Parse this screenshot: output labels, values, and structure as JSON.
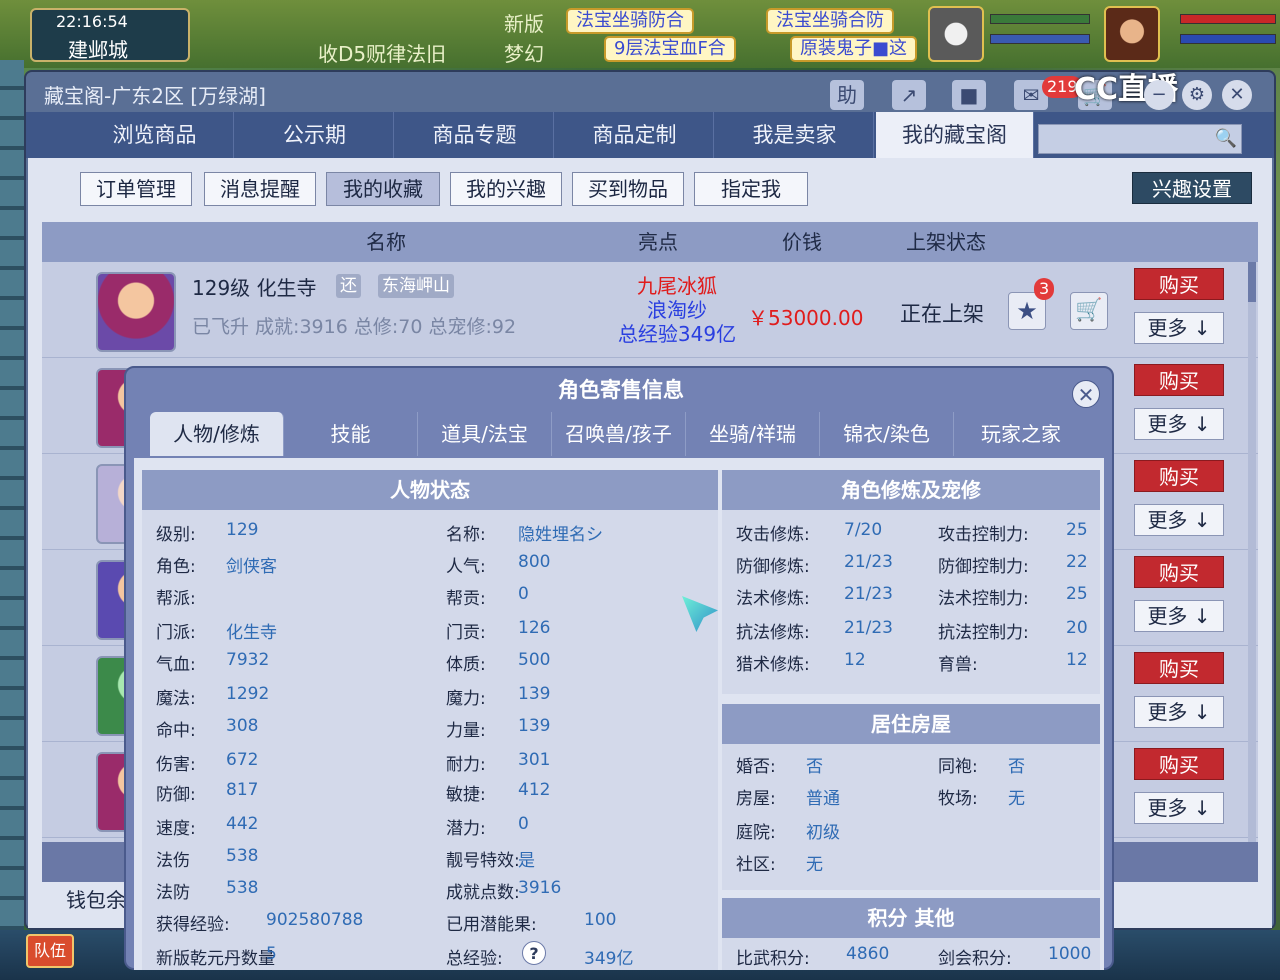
{
  "topbar": {
    "clock": "22:16:54",
    "city": "建邺城",
    "scroll": "收D5贶律法旧",
    "brand": "梦幻",
    "news_prefix": "新版",
    "announcements": [
      "法宝坐骑防合",
      "法宝坐骑合防",
      "9层法宝血F合",
      "原装鬼子■这"
    ],
    "stream_logo": "CC直播"
  },
  "window": {
    "title": "藏宝阁-广东2区 [万绿湖]",
    "help_label": "助",
    "message_badge": "219",
    "nav_tabs": [
      "浏览商品",
      "公示期",
      "商品专题",
      "商品定制",
      "我是卖家",
      "我的藏宝阁"
    ],
    "active_nav": "我的藏宝阁",
    "search_placeholder": ""
  },
  "subnav": {
    "buttons": [
      "订单管理",
      "消息提醒",
      "我的收藏",
      "我的兴趣",
      "买到物品",
      "指定我"
    ],
    "active": "我的收藏",
    "interest_settings": "兴趣设置"
  },
  "table": {
    "headers": [
      "名称",
      "亮点",
      "价钱",
      "上架状态"
    ],
    "row1": {
      "level_school": "129级  化生寺",
      "tag1": "还",
      "tag2": "东海岬山",
      "details": "已飞升  成就:3916  总修:70  总宠修:92",
      "highlight1": "九尾冰狐",
      "highlight2": "浪淘纱",
      "highlight3": "总经验349亿",
      "price": "￥53000.00",
      "status": "正在上架",
      "star_count": "3"
    },
    "buy_label": "购买",
    "more_label": "更多 ↓",
    "wallet": "钱包余"
  },
  "popup": {
    "title": "角色寄售信息",
    "tabs": [
      "人物/修炼",
      "技能",
      "道具/法宝",
      "召唤兽/孩子",
      "坐骑/祥瑞",
      "锦衣/染色",
      "玩家之家"
    ],
    "active_tab": "人物/修炼",
    "status_head": "人物状态",
    "cultivation_head": "角色修炼及宠修",
    "house_head": "居住房屋",
    "points_head": "积分 其他",
    "left_col": [
      {
        "k": "级别:",
        "v": "129"
      },
      {
        "k": "角色:",
        "v": "剑侠客"
      },
      {
        "k": "帮派:",
        "v": ""
      },
      {
        "k": "门派:",
        "v": "化生寺"
      },
      {
        "k": "气血:",
        "v": "7932"
      },
      {
        "k": "魔法:",
        "v": "1292"
      },
      {
        "k": "命中:",
        "v": "308"
      },
      {
        "k": "伤害:",
        "v": "672"
      },
      {
        "k": "防御:",
        "v": "817"
      },
      {
        "k": "速度:",
        "v": "442"
      },
      {
        "k": "法伤",
        "v": "538"
      },
      {
        "k": "法防",
        "v": "538"
      },
      {
        "k": "获得经验:",
        "v": "902580788"
      },
      {
        "k": "新版乾元丹数量",
        "v": "5"
      }
    ],
    "mid_col": [
      {
        "k": "名称:",
        "v": "隐姓埋名シ"
      },
      {
        "k": "人气:",
        "v": "800"
      },
      {
        "k": "帮贡:",
        "v": "0"
      },
      {
        "k": "门贡:",
        "v": "126"
      },
      {
        "k": "体质:",
        "v": "500"
      },
      {
        "k": "魔力:",
        "v": "139"
      },
      {
        "k": "力量:",
        "v": "139"
      },
      {
        "k": "耐力:",
        "v": "301"
      },
      {
        "k": "敏捷:",
        "v": "412"
      },
      {
        "k": "潜力:",
        "v": "0"
      },
      {
        "k": "靓号特效:",
        "v": "是"
      },
      {
        "k": "成就点数:",
        "v": "3916"
      },
      {
        "k": "已用潜能果:",
        "v": "100"
      },
      {
        "k": "总经验:",
        "v": "349亿"
      }
    ],
    "cultivation": [
      {
        "k": "攻击修炼:",
        "v": "7/20",
        "k2": "攻击控制力:",
        "v2": "25"
      },
      {
        "k": "防御修炼:",
        "v": "21/23",
        "k2": "防御控制力:",
        "v2": "22"
      },
      {
        "k": "法术修炼:",
        "v": "21/23",
        "k2": "法术控制力:",
        "v2": "25"
      },
      {
        "k": "抗法修炼:",
        "v": "21/23",
        "k2": "抗法控制力:",
        "v2": "20"
      },
      {
        "k": "猎术修炼:",
        "v": "12",
        "k2": "育兽:",
        "v2": "12"
      }
    ],
    "house": [
      {
        "k": "婚否:",
        "v": "否",
        "k2": "同袍:",
        "v2": "否"
      },
      {
        "k": "房屋:",
        "v": "普通",
        "k2": "牧场:",
        "v2": "无"
      },
      {
        "k": "庭院:",
        "v": "初级",
        "k2": "",
        "v2": ""
      },
      {
        "k": "社区:",
        "v": "无",
        "k2": "",
        "v2": ""
      }
    ],
    "points": {
      "k": "比武积分:",
      "v": "4860",
      "k2": "剑会积分:",
      "v2": "1000"
    }
  },
  "bottom": {
    "team": "队伍"
  },
  "colors": {
    "price": "#e01c1c",
    "buy": "#c2292f",
    "value": "#2f6bb4",
    "header": "#8d9bc4"
  }
}
